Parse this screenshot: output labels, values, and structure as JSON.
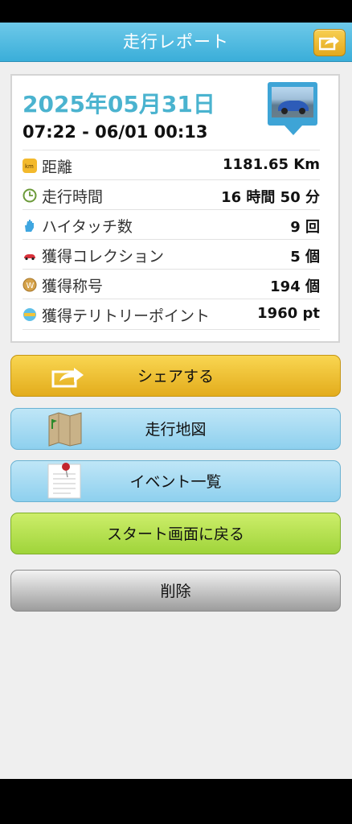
{
  "header": {
    "title": "走行レポート",
    "share_icon": "share-icon"
  },
  "report": {
    "date": "2025年05月31日",
    "time_range": "07:22 - 06/01 00:13",
    "thumbnail": "car-photo",
    "stats": [
      {
        "icon": "km-icon",
        "label": "距離",
        "value": "1181.65 Km"
      },
      {
        "icon": "clock-icon",
        "label": "走行時間",
        "value": "16 時間 50 分"
      },
      {
        "icon": "hand-icon",
        "label": "ハイタッチ数",
        "value": "9 回"
      },
      {
        "icon": "car-icon",
        "label": "獲得コレクション",
        "value": "5 個"
      },
      {
        "icon": "medal-icon",
        "label": "獲得称号",
        "value": "194 個"
      },
      {
        "icon": "territory-icon",
        "label": "獲得テリトリーポイント",
        "value": "1960 pt"
      }
    ]
  },
  "buttons": {
    "share": "シェアする",
    "map": "走行地図",
    "events": "イベント一覧",
    "start": "スタート画面に戻る",
    "delete": "削除"
  },
  "colors": {
    "header": "#3aaed9",
    "date": "#4ab3cf",
    "share_button": "#f2c33a",
    "map_button": "#a6dbf3",
    "start_button": "#b5e04d",
    "delete_button": "#c8c8c8"
  }
}
